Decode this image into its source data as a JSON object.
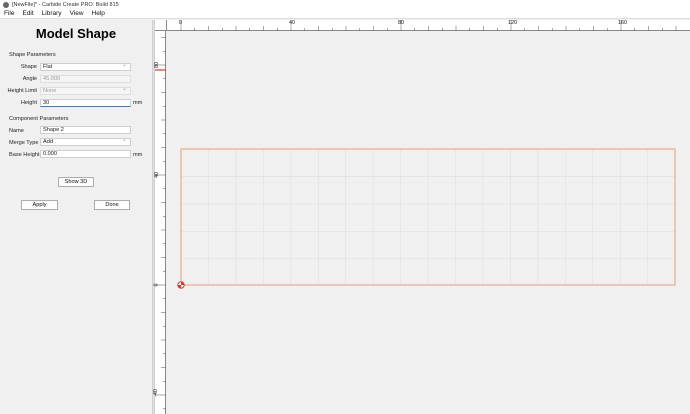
{
  "window": {
    "title": "[NewFile]* - Carbide Create PRO: Build 815"
  },
  "menu": [
    {
      "label": "File"
    },
    {
      "label": "Edit"
    },
    {
      "label": "Library"
    },
    {
      "label": "View"
    },
    {
      "label": "Help"
    }
  ],
  "panel": {
    "heading": "Model Shape",
    "shape_params_label": "Shape Parameters",
    "shape_label": "Shape",
    "shape_value": "Flat",
    "angle_label": "Angle",
    "angle_value": "45.000",
    "height_limit_label": "Height Limit",
    "height_limit_value": "None",
    "height_label": "Height",
    "height_value": "30",
    "height_unit": "mm",
    "component_params_label": "Component Parameters",
    "name_label": "Name",
    "name_value": "Shape 2",
    "merge_type_label": "Merge Type",
    "merge_type_value": "Add",
    "base_height_label": "Base Height",
    "base_height_value": "0.000",
    "base_height_unit": "mm",
    "show3d_label": "Show 3D",
    "apply_label": "Apply",
    "done_label": "Done"
  },
  "rulers": {
    "top": [
      "0",
      "40",
      "80",
      "120",
      "160"
    ],
    "left": [
      "80",
      "40",
      "0",
      "-40"
    ]
  },
  "colors": {
    "shape_outline": "#e8a070",
    "grid_line": "#dedede",
    "origin_marker": "#d83a2a"
  }
}
